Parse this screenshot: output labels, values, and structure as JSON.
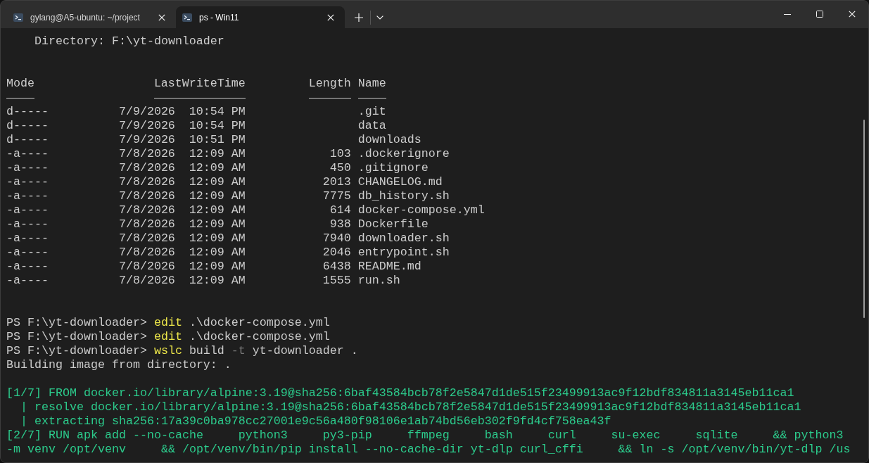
{
  "tabs": [
    {
      "title": "gylang@A5-ubuntu: ~/project",
      "selected": false
    },
    {
      "title": "ps - Win11",
      "selected": true
    }
  ],
  "terminal": {
    "directory": "Directory: F:\\yt-downloader",
    "listing": {
      "columns": [
        "Mode",
        "LastWriteTime",
        "Length",
        "Name"
      ],
      "rows": [
        {
          "mode": "d-----",
          "last_write_time": "7/9/2026  10:54 PM",
          "name": ".git"
        },
        {
          "mode": "d-----",
          "last_write_time": "7/9/2026  10:54 PM",
          "name": "data"
        },
        {
          "mode": "d-----",
          "last_write_time": "7/9/2026  10:51 PM",
          "name": "downloads"
        },
        {
          "mode": "-a----",
          "last_write_time": "7/8/2026  12:09 AM",
          "length": "103",
          "name": ".dockerignore"
        },
        {
          "mode": "-a----",
          "last_write_time": "7/8/2026  12:09 AM",
          "length": "450",
          "name": ".gitignore"
        },
        {
          "mode": "-a----",
          "last_write_time": "7/8/2026  12:09 AM",
          "length": "2013",
          "name": "CHANGELOG.md"
        },
        {
          "mode": "-a----",
          "last_write_time": "7/8/2026  12:09 AM",
          "length": "7775",
          "name": "db_history.sh"
        },
        {
          "mode": "-a----",
          "last_write_time": "7/8/2026  12:09 AM",
          "length": "614",
          "name": "docker-compose.yml"
        },
        {
          "mode": "-a----",
          "last_write_time": "7/8/2026  12:09 AM",
          "length": "938",
          "name": "Dockerfile"
        },
        {
          "mode": "-a----",
          "last_write_time": "7/8/2026  12:09 AM",
          "length": "7940",
          "name": "downloader.sh"
        },
        {
          "mode": "-a----",
          "last_write_time": "7/8/2026  12:09 AM",
          "length": "2046",
          "name": "entrypoint.sh"
        },
        {
          "mode": "-a----",
          "last_write_time": "7/8/2026  12:09 AM",
          "length": "6438",
          "name": "README.md"
        },
        {
          "mode": "-a----",
          "last_write_time": "7/8/2026  12:09 AM",
          "length": "1555",
          "name": "run.sh"
        }
      ]
    },
    "commands": [
      {
        "prompt": "PS F:\\yt-downloader>",
        "segments": [
          {
            "kind": "command",
            "text": "edit"
          },
          {
            "kind": "argument",
            "text": ".\\docker-compose.yml"
          }
        ]
      },
      {
        "prompt": "PS F:\\yt-downloader>",
        "segments": [
          {
            "kind": "command",
            "text": "edit"
          },
          {
            "kind": "argument",
            "text": ".\\docker-compose.yml"
          }
        ]
      },
      {
        "prompt": "PS F:\\yt-downloader>",
        "segments": [
          {
            "kind": "command",
            "text": "wslc"
          },
          {
            "kind": "argument",
            "text": "build"
          },
          {
            "kind": "flag",
            "text": "-t"
          },
          {
            "kind": "argument",
            "text": "yt-downloader ."
          }
        ]
      }
    ],
    "build": {
      "status": "Building image from directory: .",
      "log": [
        "[1/7] FROM docker.io/library/alpine:3.19@sha256:6baf43584bcb78f2e5847d1de515f23499913ac9f12bdf834811a3145eb11ca1",
        "  | resolve docker.io/library/alpine:3.19@sha256:6baf43584bcb78f2e5847d1de515f23499913ac9f12bdf834811a3145eb11ca1",
        "  | extracting sha256:17a39c0ba978cc27001e9c56a480f98106e1ab74bd56eb302f9fd4cf758ea43f",
        "[2/7] RUN apk add --no-cache     python3     py3-pip     ffmpeg     bash     curl     su-exec     sqlite     && python3",
        "-m venv /opt/venv     && /opt/venv/bin/pip install --no-cache-dir yt-dlp curl_cffi     && ln -s /opt/venv/bin/yt-dlp /us"
      ]
    }
  }
}
